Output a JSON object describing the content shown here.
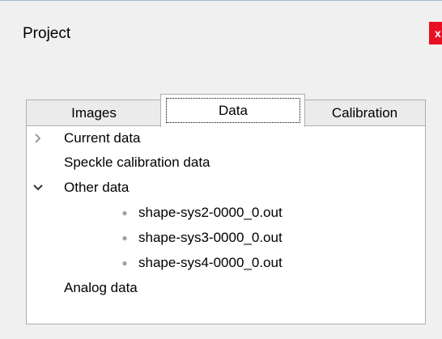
{
  "panel": {
    "title": "Project",
    "close_label": "x"
  },
  "tabs": [
    {
      "label": "Images",
      "selected": false
    },
    {
      "label": "Data",
      "selected": true
    },
    {
      "label": "Calibration",
      "selected": false
    }
  ],
  "tree": {
    "items": [
      {
        "label": "Current data",
        "expander": "collapsed"
      },
      {
        "label": "Speckle calibration data"
      },
      {
        "label": "Other data",
        "expander": "expanded"
      },
      {
        "label": "shape-sys2-0000_0.out"
      },
      {
        "label": "shape-sys3-0000_0.out"
      },
      {
        "label": "shape-sys4-0000_0.out"
      },
      {
        "label": "Analog data"
      }
    ]
  },
  "colors": {
    "close_button": "#e81123",
    "window_bg": "#f0f0f0",
    "tree_bg": "#ffffff",
    "border": "#adadad"
  }
}
